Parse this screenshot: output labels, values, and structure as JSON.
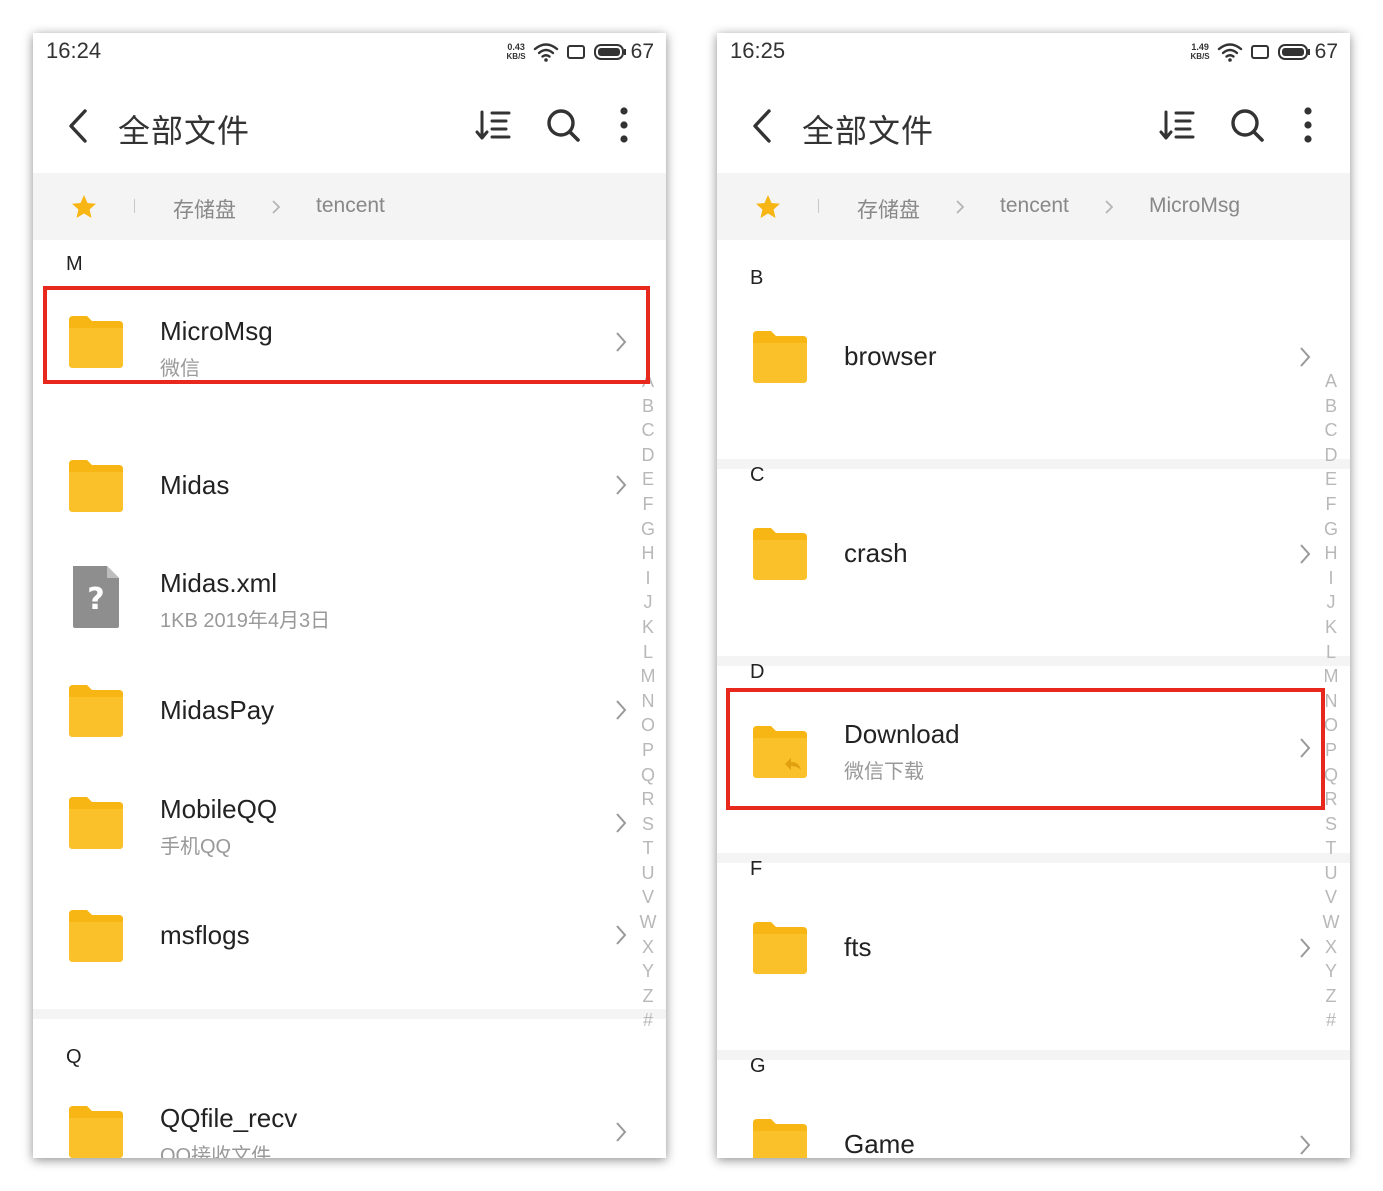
{
  "colors": {
    "folder": "#f7b614",
    "folder_tab": "#fccf3a",
    "accent_star": "#f7b614",
    "highlight": "#e8281d",
    "breadcrumb_bg": "#f4f4f4"
  },
  "index_letters": [
    "A",
    "B",
    "C",
    "D",
    "E",
    "F",
    "G",
    "H",
    "I",
    "J",
    "K",
    "L",
    "M",
    "N",
    "O",
    "P",
    "Q",
    "R",
    "S",
    "T",
    "U",
    "V",
    "W",
    "X",
    "Y",
    "Z",
    "#"
  ],
  "left": {
    "status": {
      "time": "16:24",
      "speed": "0.43",
      "speed_unit": "KB/S",
      "battery": "67"
    },
    "title": "全部文件",
    "breadcrumb": [
      "存储盘",
      "tencent"
    ],
    "sections": [
      {
        "letter": "M",
        "items": [
          {
            "name": "MicroMsg",
            "sub": "微信",
            "type": "folder",
            "highlighted": true
          },
          {
            "name": "Midas",
            "sub": "",
            "type": "folder"
          },
          {
            "name": "Midas.xml",
            "sub": "1KB  2019年4月3日",
            "type": "unknown-file"
          },
          {
            "name": "MidasPay",
            "sub": "",
            "type": "folder"
          },
          {
            "name": "MobileQQ",
            "sub": "手机QQ",
            "type": "folder"
          },
          {
            "name": "msflogs",
            "sub": "",
            "type": "folder"
          }
        ]
      },
      {
        "letter": "Q",
        "items": [
          {
            "name": "QQfile_recv",
            "sub": "QQ接收文件",
            "type": "folder"
          }
        ]
      }
    ]
  },
  "right": {
    "status": {
      "time": "16:25",
      "speed": "1.49",
      "speed_unit": "KB/S",
      "battery": "67"
    },
    "title": "全部文件",
    "breadcrumb": [
      "存储盘",
      "tencent",
      "MicroMsg"
    ],
    "sections": [
      {
        "letter": "B",
        "items": [
          {
            "name": "browser",
            "sub": "",
            "type": "folder"
          }
        ]
      },
      {
        "letter": "C",
        "items": [
          {
            "name": "crash",
            "sub": "",
            "type": "folder"
          }
        ]
      },
      {
        "letter": "D",
        "items": [
          {
            "name": "Download",
            "sub": "微信下载",
            "type": "folder-shortcut",
            "highlighted": true
          }
        ]
      },
      {
        "letter": "F",
        "items": [
          {
            "name": "fts",
            "sub": "",
            "type": "folder"
          }
        ]
      },
      {
        "letter": "G",
        "items": [
          {
            "name": "Game",
            "sub": "",
            "type": "folder"
          }
        ]
      }
    ]
  }
}
